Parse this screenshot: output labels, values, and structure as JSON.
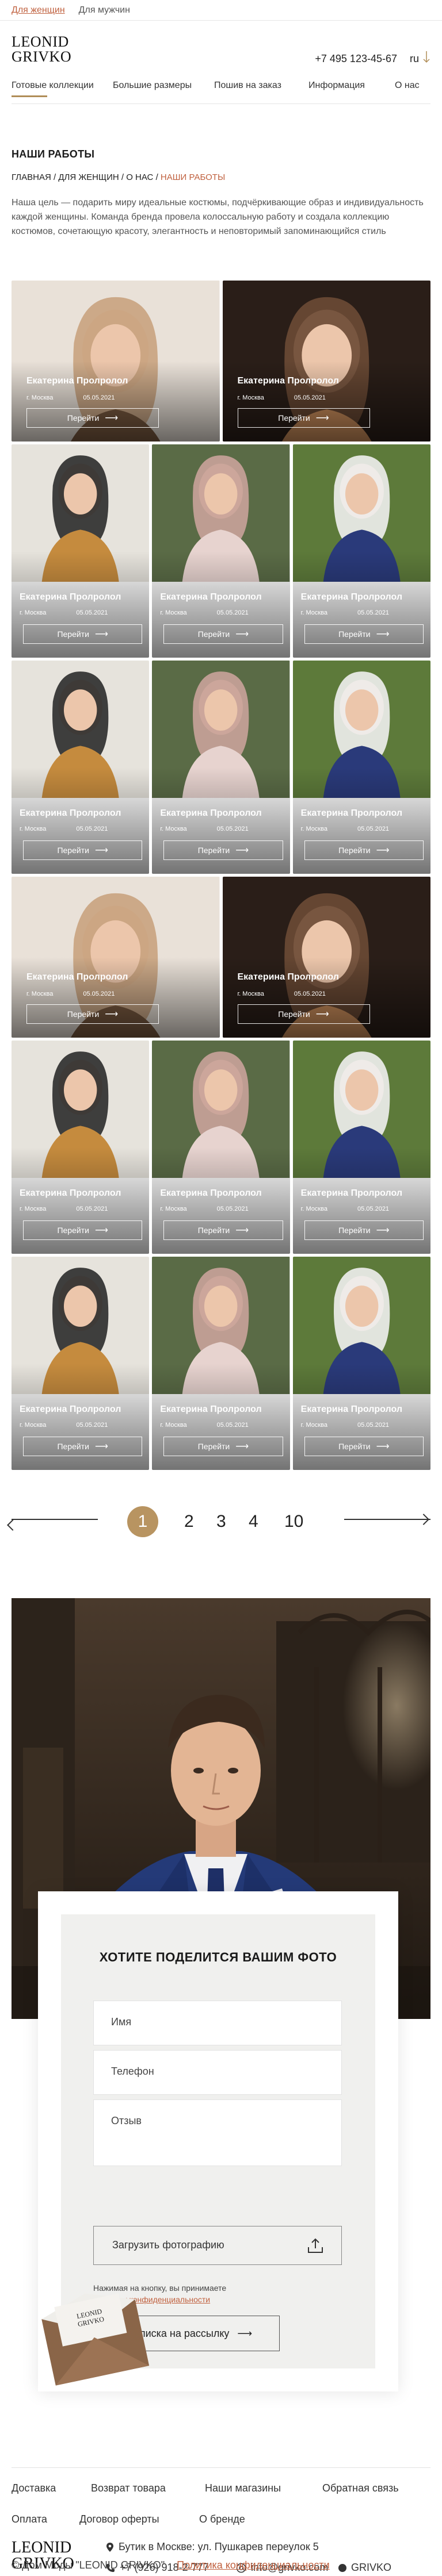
{
  "topbar": {
    "women": "Для женщин",
    "men": "Для мужчин"
  },
  "header": {
    "logo_line1": "LEONID",
    "logo_line2": "GRIVKO",
    "phone": "+7 495 123-45-67",
    "lang": "ru",
    "lang_icon": "arrow-down-icon"
  },
  "nav": {
    "items": [
      "Готовые коллекции",
      "Большие размеры",
      "Пошив на заказ",
      "Информация",
      "О нас"
    ]
  },
  "page": {
    "title": "НАШИ РАБОТЫ",
    "breadcrumbs": [
      "ГЛАВНАЯ",
      "ДЛЯ ЖЕНЩИН",
      "О НАС",
      "НАШИ РАБОТЫ"
    ],
    "intro": "Наша цель — подарить миру идеальные костюмы, подчёркивающие образ и индивидуальность каждой женщины. Команда бренда провела колоссальную работу и создала коллекцию костюмов, сочетающую красоту, элегантность и неповторимый запоминающийся стиль"
  },
  "gallery": {
    "card": {
      "name": "Екатерина Пролролол",
      "city": "г. Москва",
      "date": "05.05.2021",
      "button": "Перейти"
    },
    "colors": {
      "accent": "#b89461",
      "link": "#c0613f"
    }
  },
  "pagination": {
    "pages": [
      "1",
      "2",
      "3",
      "4",
      "10"
    ],
    "current": "1"
  },
  "share_form": {
    "title": "ХОТИТЕ ПОДЕЛИТСЯ ВАШИМ ФОТО",
    "name_placeholder": "Имя",
    "phone_placeholder": "Телефон",
    "review_placeholder": "Отзыв",
    "upload_label": "Загрузить фотографию",
    "consent_text": "Нажимая на кнопку, вы принимаете",
    "consent_link": "политику конфиденциальности",
    "subscribe_label": "Подписка на рассылку",
    "envelope_text": "LEONID GRIVKO"
  },
  "footer": {
    "links_row1": [
      "Доставка",
      "Возврат товара",
      "Наши магазины",
      "Обратная связь"
    ],
    "links_row2": [
      "Оплата",
      "Договор оферты",
      "О бренде"
    ],
    "logo_line1": "LEONID",
    "logo_line2": "GRIVKO",
    "address": "Бутик в Москве: ул. Пушкарев переулок 5",
    "phone": "+7 (926) 918-2-777",
    "email": "info@grivko.com",
    "social": "GRIVKO",
    "copyright": "© Дом Моды \"LEONID GRIVKO\"",
    "privacy": "Политика конфиденциальности"
  }
}
